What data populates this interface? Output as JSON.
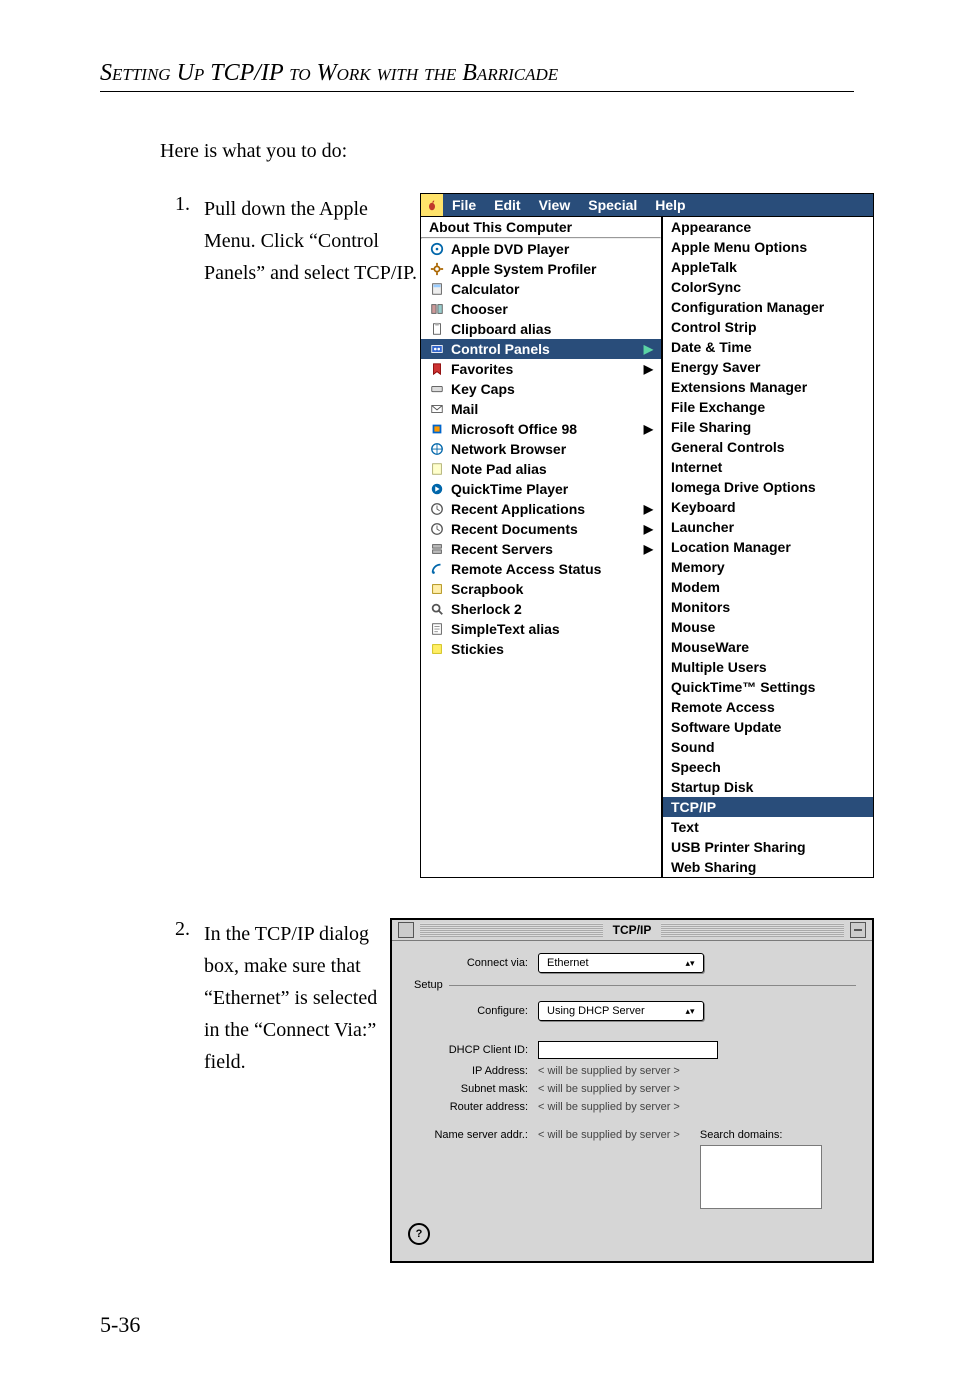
{
  "heading": "Setting Up TCP/IP to Work with the Barricade",
  "intro": "Here is what you to do:",
  "page_number": "5-36",
  "steps": {
    "one": {
      "num": "1.",
      "text": "Pull down the Apple Menu. Click “Control Panels” and select TCP/IP."
    },
    "two": {
      "num": "2.",
      "text": "In the TCP/IP dialog box, make sure that “Ethernet” is selected in the “Connect Via:” field."
    }
  },
  "menubar": [
    "File",
    "Edit",
    "View",
    "Special",
    "Help"
  ],
  "apple_menu": {
    "about": "About This Computer",
    "items": [
      {
        "label": "Apple DVD Player",
        "icon": "disc"
      },
      {
        "label": "Apple System Profiler",
        "icon": "gear"
      },
      {
        "label": "Calculator",
        "icon": "calc"
      },
      {
        "label": "Chooser",
        "icon": "chooser"
      },
      {
        "label": "Clipboard alias",
        "icon": "clip"
      },
      {
        "label": "Control Panels",
        "icon": "panel",
        "arrow": true,
        "selected": true
      },
      {
        "label": "Favorites",
        "icon": "fav",
        "arrow": true
      },
      {
        "label": "Key Caps",
        "icon": "key"
      },
      {
        "label": "Mail",
        "icon": "mail"
      },
      {
        "label": "Microsoft Office 98",
        "icon": "office",
        "arrow": true
      },
      {
        "label": "Network Browser",
        "icon": "net"
      },
      {
        "label": "Note Pad alias",
        "icon": "note"
      },
      {
        "label": "QuickTime Player",
        "icon": "qt"
      },
      {
        "label": "Recent Applications",
        "icon": "recent",
        "arrow": true
      },
      {
        "label": "Recent Documents",
        "icon": "recent",
        "arrow": true
      },
      {
        "label": "Recent Servers",
        "icon": "server",
        "arrow": true
      },
      {
        "label": "Remote Access Status",
        "icon": "remote"
      },
      {
        "label": "Scrapbook",
        "icon": "scrap"
      },
      {
        "label": "Sherlock 2",
        "icon": "sherlock"
      },
      {
        "label": "SimpleText alias",
        "icon": "text"
      },
      {
        "label": "Stickies",
        "icon": "sticky"
      }
    ]
  },
  "control_panels": [
    {
      "label": "Appearance"
    },
    {
      "label": "Apple Menu Options"
    },
    {
      "label": "AppleTalk"
    },
    {
      "label": "ColorSync"
    },
    {
      "label": "Configuration Manager"
    },
    {
      "label": "Control Strip"
    },
    {
      "label": "Date & Time"
    },
    {
      "label": "Energy Saver"
    },
    {
      "label": "Extensions Manager"
    },
    {
      "label": "File Exchange"
    },
    {
      "label": "File Sharing"
    },
    {
      "label": "General Controls"
    },
    {
      "label": "Internet"
    },
    {
      "label": "Iomega Drive Options"
    },
    {
      "label": "Keyboard"
    },
    {
      "label": "Launcher"
    },
    {
      "label": "Location Manager"
    },
    {
      "label": "Memory"
    },
    {
      "label": "Modem"
    },
    {
      "label": "Monitors"
    },
    {
      "label": "Mouse"
    },
    {
      "label": "MouseWare"
    },
    {
      "label": "Multiple Users"
    },
    {
      "label": "QuickTime™ Settings"
    },
    {
      "label": "Remote Access"
    },
    {
      "label": "Software Update"
    },
    {
      "label": "Sound"
    },
    {
      "label": "Speech"
    },
    {
      "label": "Startup Disk"
    },
    {
      "label": "TCP/IP",
      "selected": true
    },
    {
      "label": "Text"
    },
    {
      "label": "USB Printer Sharing"
    },
    {
      "label": "Web Sharing"
    }
  ],
  "tcpip": {
    "title": "TCP/IP",
    "connect_via_label": "Connect via:",
    "connect_via_value": "Ethernet",
    "setup_legend": "Setup",
    "configure_label": "Configure:",
    "configure_value": "Using DHCP Server",
    "dhcp_client_id_label": "DHCP Client ID:",
    "dhcp_client_id_value": "",
    "ip_address_label": "IP Address:",
    "subnet_mask_label": "Subnet mask:",
    "router_address_label": "Router address:",
    "name_server_label": "Name server addr.:",
    "supplied_text": "< will be supplied by server >",
    "search_domains_label": "Search domains:",
    "help_glyph": "?"
  }
}
